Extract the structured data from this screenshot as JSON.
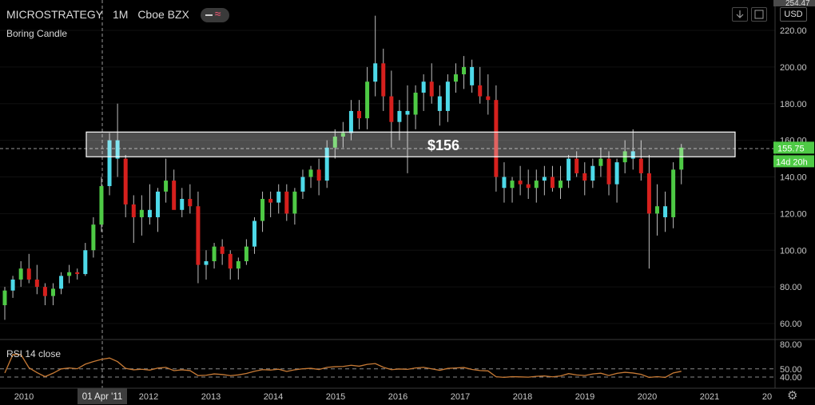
{
  "header": {
    "symbol": "MICROSTRATEGY",
    "interval": "1M",
    "exchange": "Cboe BZX",
    "study_label": "Boring Candle",
    "currency_button": "USD",
    "top_price_partial": "254.47"
  },
  "rsi": {
    "label": "RSI 14 close"
  },
  "chart_data": {
    "type": "candlestick",
    "price_axis": {
      "ticks": [
        60,
        80,
        100,
        120,
        140,
        160,
        180,
        200,
        220
      ],
      "ylim": [
        48,
        230
      ]
    },
    "x_axis": {
      "ticks": [
        "2010",
        "2012",
        "2013",
        "2014",
        "2015",
        "2016",
        "2017",
        "2018",
        "2019",
        "2020",
        "2021",
        "20"
      ]
    },
    "crosshair_label": "01 Apr '11",
    "zone": {
      "low": 151,
      "high": 164.5,
      "label": "$156"
    },
    "last_price": {
      "value": 155.75,
      "label": "155.75",
      "countdown": "14d 20h"
    },
    "colors": {
      "up": "#4eca45",
      "down": "#d6201d",
      "alt": "#4dd9e8",
      "rsi_line": "#c77a35",
      "background": "#000000"
    },
    "candles": [
      [
        70,
        80,
        62,
        78
      ],
      [
        78,
        86,
        74,
        84
      ],
      [
        84,
        94,
        80,
        90
      ],
      [
        90,
        98,
        82,
        84
      ],
      [
        84,
        92,
        76,
        80
      ],
      [
        80,
        82,
        70,
        75
      ],
      [
        75,
        82,
        70,
        79
      ],
      [
        79,
        88,
        76,
        86
      ],
      [
        86,
        92,
        82,
        88
      ],
      [
        88,
        90,
        84,
        87
      ],
      [
        87,
        104,
        86,
        100
      ],
      [
        100,
        118,
        96,
        114
      ],
      [
        114,
        140,
        110,
        135
      ],
      [
        135,
        164,
        130,
        160
      ],
      [
        160,
        180,
        140,
        150
      ],
      [
        150,
        152,
        118,
        125
      ],
      [
        125,
        130,
        104,
        118
      ],
      [
        118,
        130,
        108,
        122
      ],
      [
        122,
        136,
        114,
        118
      ],
      [
        118,
        134,
        110,
        132
      ],
      [
        132,
        150,
        126,
        138
      ],
      [
        138,
        144,
        128,
        122
      ],
      [
        122,
        134,
        118,
        128
      ],
      [
        128,
        136,
        120,
        124
      ],
      [
        124,
        132,
        82,
        92
      ],
      [
        92,
        100,
        84,
        94
      ],
      [
        94,
        104,
        90,
        102
      ],
      [
        102,
        106,
        92,
        98
      ],
      [
        98,
        100,
        84,
        90
      ],
      [
        90,
        96,
        84,
        94
      ],
      [
        94,
        106,
        92,
        102
      ],
      [
        102,
        118,
        98,
        116
      ],
      [
        116,
        132,
        110,
        128
      ],
      [
        128,
        132,
        118,
        126
      ],
      [
        126,
        136,
        120,
        132
      ],
      [
        132,
        136,
        116,
        120
      ],
      [
        120,
        134,
        114,
        132
      ],
      [
        132,
        144,
        128,
        140
      ],
      [
        140,
        146,
        134,
        144
      ],
      [
        144,
        150,
        130,
        138
      ],
      [
        138,
        160,
        134,
        156
      ],
      [
        156,
        166,
        150,
        162
      ],
      [
        162,
        170,
        156,
        164
      ],
      [
        164,
        182,
        160,
        176
      ],
      [
        176,
        182,
        166,
        172
      ],
      [
        172,
        200,
        166,
        192
      ],
      [
        192,
        228,
        184,
        202
      ],
      [
        202,
        210,
        176,
        184
      ],
      [
        184,
        198,
        156,
        170
      ],
      [
        170,
        182,
        160,
        176
      ],
      [
        176,
        190,
        142,
        174
      ],
      [
        174,
        190,
        166,
        186
      ],
      [
        186,
        196,
        176,
        192
      ],
      [
        192,
        202,
        180,
        184
      ],
      [
        184,
        190,
        168,
        176
      ],
      [
        176,
        196,
        170,
        192
      ],
      [
        192,
        202,
        186,
        196
      ],
      [
        196,
        206,
        188,
        200
      ],
      [
        200,
        204,
        186,
        190
      ],
      [
        190,
        200,
        180,
        184
      ],
      [
        184,
        196,
        174,
        182
      ],
      [
        182,
        190,
        132,
        140
      ],
      [
        140,
        148,
        126,
        134
      ],
      [
        134,
        140,
        126,
        138
      ],
      [
        138,
        146,
        130,
        136
      ],
      [
        136,
        144,
        128,
        134
      ],
      [
        134,
        144,
        126,
        138
      ],
      [
        138,
        146,
        130,
        140
      ],
      [
        140,
        146,
        132,
        134
      ],
      [
        134,
        146,
        128,
        138
      ],
      [
        138,
        152,
        134,
        150
      ],
      [
        150,
        154,
        140,
        142
      ],
      [
        142,
        148,
        130,
        138
      ],
      [
        138,
        150,
        134,
        146
      ],
      [
        146,
        156,
        140,
        150
      ],
      [
        150,
        154,
        130,
        136
      ],
      [
        136,
        150,
        126,
        148
      ],
      [
        148,
        160,
        142,
        154
      ],
      [
        154,
        166,
        144,
        150
      ],
      [
        150,
        160,
        138,
        142
      ],
      [
        142,
        152,
        90,
        120
      ],
      [
        120,
        136,
        108,
        124
      ],
      [
        124,
        132,
        110,
        118
      ],
      [
        118,
        148,
        112,
        144
      ],
      [
        144,
        158,
        136,
        156
      ]
    ],
    "rsi_levels": [
      40,
      50,
      80
    ]
  }
}
